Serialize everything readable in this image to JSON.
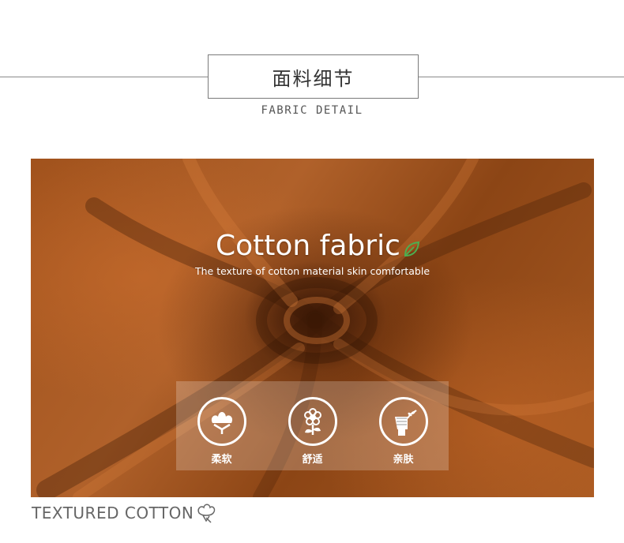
{
  "header": {
    "title": "面料细节",
    "subtitle": "FABRIC DETAIL"
  },
  "banner": {
    "headline": "Cotton fabric",
    "tagline": "The texture of cotton material skin comfortable",
    "features": [
      {
        "icon": "cotton-boll-icon",
        "label": "柔软"
      },
      {
        "icon": "flower-icon",
        "label": "舒适"
      },
      {
        "icon": "hand-holding-leaves-icon",
        "label": "亲肤"
      }
    ],
    "fabric_color": "#a1521c",
    "leaf_color": "#4caf50"
  },
  "footer": {
    "caption": "TEXTURED COTTON",
    "icon": "cotton-icon"
  }
}
